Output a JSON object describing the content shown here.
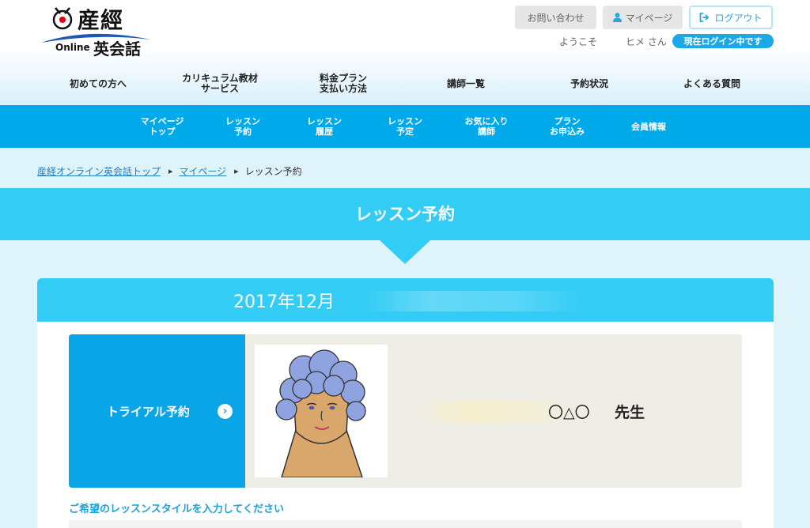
{
  "logo": {
    "kanji": "産經",
    "online": "Online",
    "eikaiwa": "英会話"
  },
  "header": {
    "contact_label": "お問い合わせ",
    "mypage_label": "マイページ",
    "logout_label": "ログアウト",
    "welcome": "ようこそ",
    "username": "ヒメ さん",
    "login_status": "現在ログイン中です"
  },
  "main_nav": [
    {
      "label": "初めての方へ"
    },
    {
      "label": "カリキュラム教材\nサービス"
    },
    {
      "label": "料金プラン\n支払い方法"
    },
    {
      "label": "講師一覧"
    },
    {
      "label": "予約状況"
    },
    {
      "label": "よくある質問"
    }
  ],
  "sub_nav": [
    {
      "label": "マイページ\nトップ"
    },
    {
      "label": "レッスン\n予約"
    },
    {
      "label": "レッスン\n履歴"
    },
    {
      "label": "レッスン\n予定"
    },
    {
      "label": "お気に入り\n講師"
    },
    {
      "label": "プラン\nお申込み"
    },
    {
      "label": "会員情報"
    }
  ],
  "breadcrumb": [
    {
      "label": "産経オンライン英会話トップ"
    },
    {
      "label": "マイページ"
    },
    {
      "label": "レッスン予約"
    }
  ],
  "page_title": "レッスン予約",
  "calendar": {
    "month": "2017年12月"
  },
  "teacher": {
    "trial_label": "トライアル予約",
    "name": "〇△〇",
    "suffix": "先生"
  },
  "style_prompt": "ご希望のレッスンスタイルを入力してください",
  "colors": {
    "brand_blue": "#00a9ea",
    "light_blue": "#33ccf5",
    "pale_blue": "#dff3fb",
    "trial_blue": "#0aa5e6",
    "prompt_blue": "#1aa3de"
  },
  "icons": {
    "mypage": "person-icon",
    "logout": "logout-icon",
    "crumb_separator": "triangle-right-icon",
    "trial": "chevron-right-circle-icon"
  }
}
